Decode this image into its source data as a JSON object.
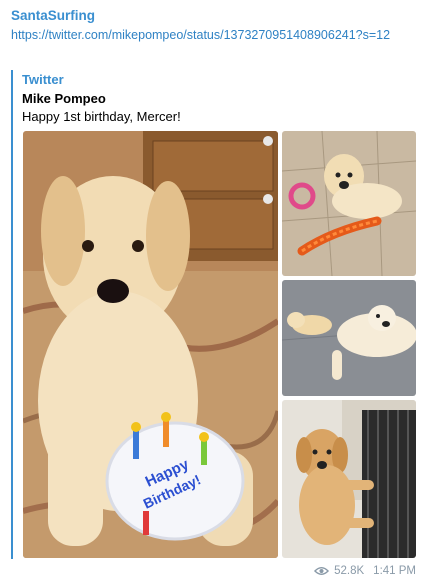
{
  "message": {
    "sender": "SantaSurfing",
    "link": "https://twitter.com/mikepompeo/status/1373270951408906241?s=12",
    "preview": {
      "source": "Twitter",
      "author": "Mike Pompeo",
      "text": "Happy 1st birthday, Mercer!"
    },
    "views": "52.8K",
    "time": "1:41 PM",
    "photo_subjects": [
      "golden-retriever-with-birthday-cake-toy",
      "puppy-with-rope-toys",
      "puppy-and-dog-on-floor",
      "puppy-standing-at-gate"
    ]
  },
  "colors": {
    "accent": "#3a8fd0",
    "link": "#2f82c4",
    "meta": "#8a9aa8"
  }
}
